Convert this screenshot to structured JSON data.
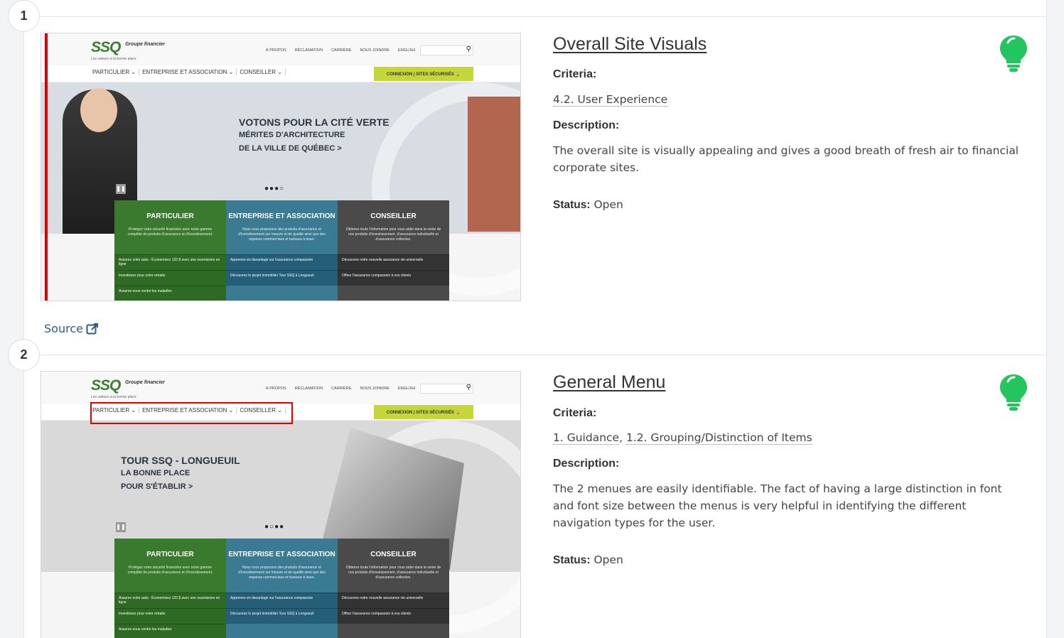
{
  "colors": {
    "accent_green": "#22c55e",
    "link": "#2b5c8a",
    "highlight_red": "#e00000"
  },
  "findings": [
    {
      "number": "1",
      "title": "Overall Site Visuals",
      "criteria_label": "Criteria:",
      "criteria": [
        "4.2. User Experience"
      ],
      "description_label": "Description:",
      "description": "The overall site is visually appealing and gives a good breath of fresh air to financial corporate sites.",
      "status_label": "Status:",
      "status": "Open",
      "icon": "lightbulb-icon",
      "source_label": "Source",
      "screenshot": {
        "logo": "SSQ",
        "logo_sub": "Groupe financier",
        "tagline": "Les valeurs à la bonne place",
        "top_links": [
          "À PROPOS",
          "RÉCLAMATION",
          "CARRIÈRE",
          "NOUS JOINDRE",
          "ENGLISH"
        ],
        "nav": [
          "PARTICULIER ⌄",
          "ENTREPRISE ET ASSOCIATION ⌄",
          "CONSEILLER ⌄"
        ],
        "login": "CONNEXION | SITES SÉCURISÉS 🔒",
        "headline": "VOTONS POUR LA CITÉ VERTE",
        "headline_sub1": "MÉRITES D'ARCHITECTURE",
        "headline_sub2": "DE LA VILLE DE QUÉBEC >",
        "dots": "●●●○",
        "cards": [
          {
            "title": "PARTICULIER",
            "desc": "Protégez votre sécurité financière avec notre gamme complète de produits d'assurance et d'investissement.",
            "link1": "Assurez votre auto - Économisez 120 $ avec une soumission en ligne",
            "link2": "Investissez pour votre retraite",
            "link3": "Assurez-vous contre les maladies"
          },
          {
            "title": "ENTREPRISE ET ASSOCIATION",
            "desc": "Nous vous proposons des produits d'assurance et d'investissement sur mesure et de qualité ainsi que des espaces commerciaux et bureaux à louer.",
            "link1": "Apprenez-en davantage sur l'assurance compassion",
            "link2": "Découvrez le projet immobilier Tour SSQ à Longueuil",
            "link3": ""
          },
          {
            "title": "CONSEILLER",
            "desc": "Obtenez toute l'information pour vous aider dans la vente de nos produits d'investissement, d'assurance individuelle et d'assurance collective.",
            "link1": "Découvrez notre nouvelle assurance vie universelle",
            "link2": "Offrez l'assurance compassion à vos clients",
            "link3": ""
          }
        ]
      }
    },
    {
      "number": "2",
      "title": "General Menu",
      "criteria_label": "Criteria:",
      "criteria": [
        "1. Guidance",
        "1.2. Grouping/Distinction of Items"
      ],
      "description_label": "Description:",
      "description": "The 2 menues are easily identifiable. The fact of having a large distinction in font and font size between the menus is very helpful in identifying the different navigation types for the user.",
      "status_label": "Status:",
      "status": "Open",
      "icon": "lightbulb-icon",
      "screenshot": {
        "logo": "SSQ",
        "logo_sub": "Groupe financier",
        "tagline": "Les valeurs à la bonne place",
        "top_links": [
          "À PROPOS",
          "RÉCLAMATION",
          "CARRIÈRE",
          "NOUS JOINDRE",
          "ENGLISH"
        ],
        "nav": [
          "PARTICULIER ⌄",
          "ENTREPRISE ET ASSOCIATION ⌄",
          "CONSEILLER ⌄"
        ],
        "login": "CONNEXION | SITES SÉCURISÉS 🔒",
        "headline": "TOUR SSQ - LONGUEUIL",
        "headline_sub1": "LA BONNE PLACE",
        "headline_sub2": "POUR S'ÉTABLIR >",
        "dots": "●○●●",
        "cards": [
          {
            "title": "PARTICULIER",
            "desc": "Protégez votre sécurité financière avec notre gamme complète de produits d'assurance et d'investissement.",
            "link1": "Assurez votre auto - Économisez 120 $ avec une soumission en ligne",
            "link2": "Investissez pour votre retraite",
            "link3": "Assurez-vous contre les maladies"
          },
          {
            "title": "ENTREPRISE ET ASSOCIATION",
            "desc": "Nous vous proposons des produits d'assurance et d'investissement sur mesure et de qualité ainsi que des espaces commerciaux et bureaux à louer.",
            "link1": "Apprenez-en davantage sur l'assurance compassion",
            "link2": "Découvrez le projet immobilier Tour SSQ à Longueuil",
            "link3": ""
          },
          {
            "title": "CONSEILLER",
            "desc": "Obtenez toute l'information pour vous aider dans la vente de nos produits d'investissement, d'assurance individuelle et d'assurance collective.",
            "link1": "Découvrez notre nouvelle assurance vie universelle",
            "link2": "Offrez l'assurance compassion à vos clients",
            "link3": ""
          }
        ]
      }
    }
  ]
}
